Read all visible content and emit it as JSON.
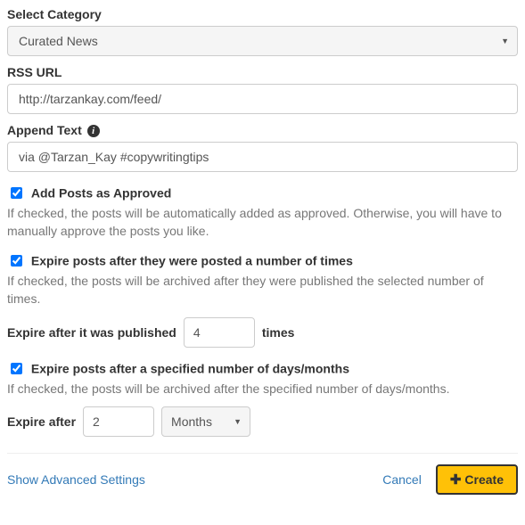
{
  "category": {
    "label": "Select Category",
    "value": "Curated News"
  },
  "rss": {
    "label": "RSS URL",
    "value": "http://tarzankay.com/feed/"
  },
  "append": {
    "label": "Append Text",
    "value": "via @Tarzan_Kay #copywritingtips"
  },
  "approved": {
    "label": "Add Posts as Approved",
    "help": "If checked, the posts will be automatically added as approved. Otherwise, you will have to manually approve the posts you like."
  },
  "expire_times": {
    "label": "Expire posts after they were posted a number of times",
    "help": "If checked, the posts will be archived after they were published the selected number of times.",
    "prefix": "Expire after it was published",
    "value": "4",
    "suffix": "times"
  },
  "expire_duration": {
    "label": "Expire posts after a specified number of days/months",
    "help": "If checked, the posts will be archived after the specified number of days/months.",
    "prefix": "Expire after",
    "value": "2",
    "unit": "Months"
  },
  "footer": {
    "advanced": "Show Advanced Settings",
    "cancel": "Cancel",
    "create": "Create"
  }
}
